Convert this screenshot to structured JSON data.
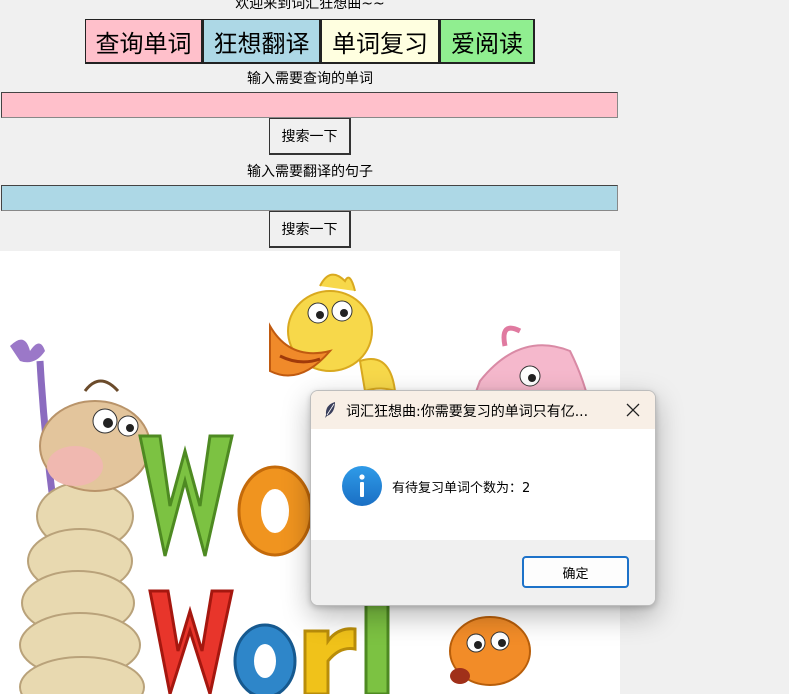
{
  "app": {
    "welcome": "欢迎来到词汇狂想曲~~",
    "tabs": [
      {
        "label": "查询单词",
        "color": "#ffc0cb"
      },
      {
        "label": "狂想翻译",
        "color": "#add8e6"
      },
      {
        "label": "单词复习",
        "color": "#ffffe0"
      },
      {
        "label": "爱阅读",
        "color": "#90ee90"
      }
    ],
    "word_search": {
      "label": "输入需要查询的单词",
      "value": "",
      "field_color": "#ffc0cb",
      "button_label": "搜索一下"
    },
    "sentence_translate": {
      "label": "输入需要翻译的句子",
      "value": "",
      "field_color": "#add8e6",
      "button_label": "搜索一下"
    }
  },
  "dialog": {
    "title": "词汇狂想曲:你需要复习的单词只有亿...",
    "icon": "info-icon",
    "message": "有待复习单词个数为：2",
    "ok_label": "确定",
    "accent": "#1d72c9"
  }
}
